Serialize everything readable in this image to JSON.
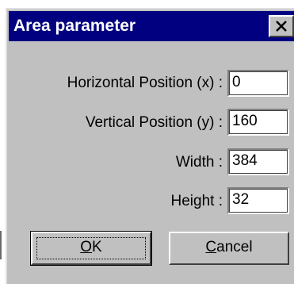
{
  "window": {
    "title": "Area parameter",
    "close_icon": "close-icon"
  },
  "fields": [
    {
      "label": "Horizontal Position (x) :",
      "value": "0"
    },
    {
      "label": "Vertical Position (y) :",
      "value": "160"
    },
    {
      "label": "Width :",
      "value": "384"
    },
    {
      "label": "Height :",
      "value": "32"
    }
  ],
  "buttons": {
    "ok": {
      "mnemonic": "O",
      "rest": "K"
    },
    "cancel": {
      "mnemonic": "C",
      "rest": "ancel"
    }
  },
  "colors": {
    "titlebar": "#000080",
    "face": "#c0c0c0"
  }
}
